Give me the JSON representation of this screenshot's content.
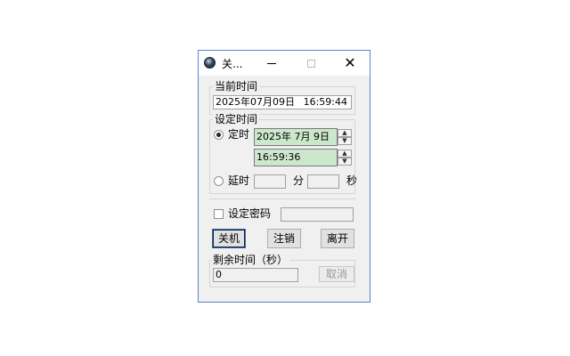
{
  "window": {
    "title": "关...",
    "close_glyph": "✕"
  },
  "current_time": {
    "legend": "当前时间",
    "date": "2025年07月09日",
    "time": "16:59:44"
  },
  "set_time": {
    "legend": "设定时间",
    "scheduled_label": "定时",
    "date_picker_value": "2025年  7月  9日",
    "time_picker_value": "16:59:36",
    "delay_label": "延时",
    "minutes_unit": "分",
    "seconds_unit": "秒",
    "selected_mode": "scheduled"
  },
  "password": {
    "label": "设定密码",
    "checked": false
  },
  "buttons": {
    "shutdown": "关机",
    "logoff": "注销",
    "exit": "离开"
  },
  "remaining": {
    "legend": "剩余时间（秒）",
    "value": "0",
    "cancel_label": "取消"
  },
  "icons": {
    "spin_up": "▲",
    "spin_down": "▼"
  }
}
